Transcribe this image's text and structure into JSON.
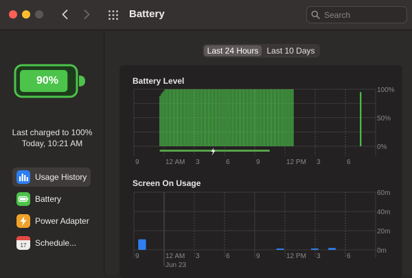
{
  "window": {
    "title": "Battery",
    "search_placeholder": "Search"
  },
  "sidebar": {
    "battery_percent": "90%",
    "battery_level": 0.9,
    "last_charged": "Last charged to 100%",
    "last_charged_time": "Today, 10:21 AM",
    "items": [
      {
        "label": "Usage History",
        "icon": "chart-bars-icon",
        "color": "#2d7ef0",
        "active": true
      },
      {
        "label": "Battery",
        "icon": "battery-icon",
        "color": "#4cc34a",
        "active": false
      },
      {
        "label": "Power Adapter",
        "icon": "bolt-icon",
        "color": "#f0a22a",
        "active": false
      },
      {
        "label": "Schedule...",
        "icon": "calendar-icon",
        "color": "#e8e6e6",
        "active": false
      }
    ]
  },
  "tabs": [
    {
      "label": "Last 24 Hours",
      "selected": true
    },
    {
      "label": "Last 10 Days",
      "selected": false
    }
  ],
  "colors": {
    "battery_green": "#4cc34a",
    "usage_blue": "#2f7ff0",
    "charging_bar": "#57a24a"
  },
  "chart_data": [
    {
      "type": "bar",
      "title": "Battery Level",
      "x_tick_labels": [
        "9",
        "12 AM",
        "3",
        "6",
        "9",
        "12 PM",
        "3",
        "6"
      ],
      "y_tick_labels": [
        "100%",
        "50%",
        "0%"
      ],
      "ylim": [
        0,
        100
      ],
      "grid": true,
      "series": [
        {
          "values": [
            88,
            92,
            95,
            97,
            100,
            100,
            100,
            100,
            100,
            100,
            100,
            100,
            100,
            100,
            100,
            100,
            100,
            100,
            100,
            100,
            100,
            100,
            100,
            100,
            100,
            100,
            100,
            100,
            100,
            100,
            100,
            100,
            100,
            100,
            100,
            100,
            100,
            100,
            100,
            100,
            100,
            100,
            100,
            100,
            100,
            100,
            100,
            100,
            100,
            100,
            100,
            100,
            100,
            100,
            100,
            100,
            100,
            100,
            100,
            100,
            100,
            100,
            100,
            100,
            100,
            100,
            100,
            100,
            100,
            100,
            100,
            100,
            100,
            100,
            100,
            100,
            100,
            100,
            100,
            100,
            100,
            100,
            100,
            100,
            100,
            100,
            100,
            100,
            100,
            100,
            100,
            100,
            100,
            100,
            100,
            100,
            100,
            100,
            100,
            100
          ]
        },
        {
          "values": [
            95
          ]
        }
      ],
      "charging_segment": {
        "start_tick": "12 AM",
        "end_tick": "12 PM",
        "icon": "bolt-icon"
      }
    },
    {
      "type": "bar",
      "title": "Screen On Usage",
      "x_tick_labels": [
        "9",
        "12 AM",
        "3",
        "6",
        "9",
        "12 PM",
        "3",
        "6"
      ],
      "x_sublabel": "Jun 23",
      "y_tick_labels": [
        "60m",
        "40m",
        "20m",
        "0m"
      ],
      "ylim": [
        0,
        60
      ],
      "grid": true,
      "series": [
        {
          "values": [
            11,
            0,
            0,
            0,
            0,
            0,
            0,
            0,
            1,
            0,
            1,
            2,
            0,
            0
          ]
        }
      ]
    }
  ]
}
